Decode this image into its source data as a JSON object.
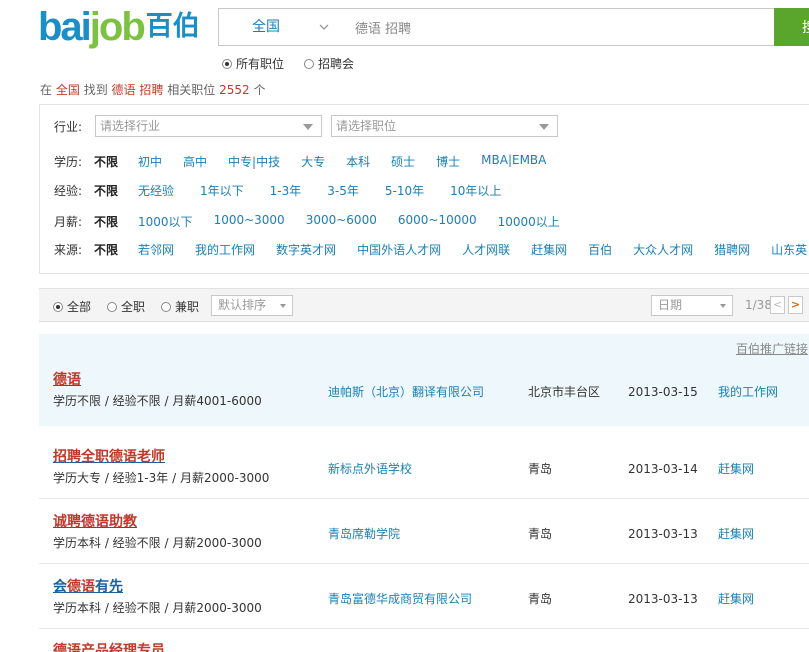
{
  "logo": {
    "latin_a": "bai",
    "latin_b": "job",
    "cn": "百伯"
  },
  "search": {
    "city": "全国",
    "query": "德语 招聘",
    "button": "搜"
  },
  "search_type": {
    "opt1": "所有职位",
    "opt2": "招聘会"
  },
  "summary": {
    "pre": "在",
    "region": "全国",
    "mid": "找到",
    "kw1": "德语",
    "kw2": "招聘",
    "post": "相关职位",
    "count": "2552",
    "unit": "个"
  },
  "filters": {
    "industry_label": "行业:",
    "industry_placeholder": "请选择行业",
    "position_placeholder": "请选择职位",
    "nolimit": "不限",
    "education": {
      "label": "学历:",
      "options": [
        "初中",
        "高中",
        "中专|中技",
        "大专",
        "本科",
        "硕士",
        "博士",
        "MBA|EMBA"
      ]
    },
    "experience": {
      "label": "经验:",
      "options": [
        "无经验",
        "1年以下",
        "1-3年",
        "3-5年",
        "5-10年",
        "10年以上"
      ]
    },
    "salary": {
      "label": "月薪:",
      "options": [
        "1000以下",
        "1000~3000",
        "3000~6000",
        "6000~10000",
        "10000以上"
      ]
    },
    "source": {
      "label": "来源:",
      "options": [
        "若邻网",
        "我的工作网",
        "数字英才网",
        "中国外语人才网",
        "人才网联",
        "赶集网",
        "百伯",
        "大众人才网",
        "猎聘网",
        "山东英"
      ]
    }
  },
  "toolbar": {
    "all": "全部",
    "fulltime": "全职",
    "parttime": "兼职",
    "sort": "默认排序",
    "date": "日期",
    "page": "1/38",
    "prev": "<",
    "next": ">"
  },
  "promo_link": "百伯推广链接",
  "jobs": [
    {
      "title_pre": "",
      "title_kw": "德语",
      "title_post": "",
      "meta": "学历不限 / 经验不限 / 月薪4001-6000",
      "company": "迪帕斯（北京）翻译有限公司",
      "location": "北京市丰台区",
      "date": "2013-03-15",
      "source": "我的工作网"
    },
    {
      "title_pre": "招聘全职",
      "title_kw": "德语",
      "title_post": "老师",
      "meta": "学历大专 / 经验1-3年 / 月薪2000-3000",
      "company": "新标点外语学校",
      "location": "青岛",
      "date": "2013-03-14",
      "source": "赶集网"
    },
    {
      "title_pre": "诚聘",
      "title_kw": "德语",
      "title_post": "助教",
      "meta": "学历本科 / 经验不限 / 月薪2000-3000",
      "company": "青岛席勒学院",
      "location": "青岛",
      "date": "2013-03-13",
      "source": "赶集网"
    },
    {
      "title_pre": "会",
      "title_kw": "德语",
      "title_post": "有先",
      "meta": "学历本科 / 经验不限 / 月薪2000-3000",
      "company": "青岛富德华成商贸有限公司",
      "location": "青岛",
      "date": "2013-03-13",
      "source": "赶集网"
    },
    {
      "title_pre": "",
      "title_kw": "德语",
      "title_post": "产品经理专员",
      "meta": "",
      "company": "",
      "location": "",
      "date": "",
      "source": ""
    }
  ]
}
